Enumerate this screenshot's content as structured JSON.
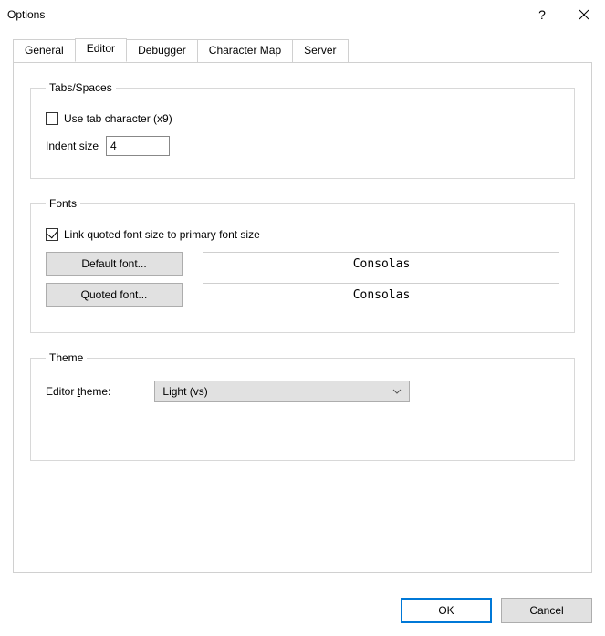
{
  "window": {
    "title": "Options"
  },
  "tabs": {
    "general": "General",
    "editor": "Editor",
    "debugger": "Debugger",
    "charmap": "Character Map",
    "server": "Server"
  },
  "groups": {
    "tabs_spaces": {
      "legend": "Tabs/Spaces",
      "use_tab_label": "Use tab character (x9)",
      "indent_label_pre": "I",
      "indent_label_post": "ndent size",
      "indent_value": "4"
    },
    "fonts": {
      "legend": "Fonts",
      "link_label": "Link quoted font size to primary font size",
      "default_btn": "Default font...",
      "default_value": "Consolas",
      "quoted_btn": "Quoted font...",
      "quoted_value": "Consolas"
    },
    "theme": {
      "legend": "Theme",
      "label_pre": "Editor ",
      "label_u": "t",
      "label_post": "heme:",
      "value": "Light (vs)"
    }
  },
  "buttons": {
    "ok": "OK",
    "cancel": "Cancel"
  }
}
